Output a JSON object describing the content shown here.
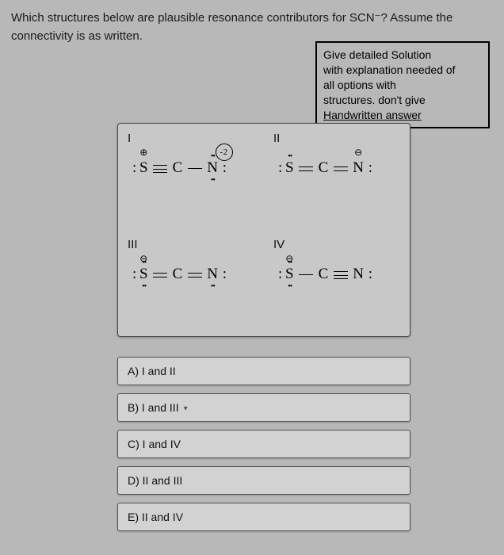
{
  "question": "Which structures below are plausible resonance contributors for SCN⁻? Assume the connectivity is as written.",
  "note": {
    "line1": "Give detailed Solution",
    "line2": "with explanation needed of",
    "line3": "all options with",
    "line4": "structures. don't give",
    "line5": "Handwritten answer"
  },
  "structures": {
    "I": {
      "roman": "I",
      "s_charge": "⊕",
      "n_charge_circle": "-2",
      "s_dots_left": ":",
      "n_dots_top": "••",
      "n_dots_bot": "••",
      "bond1": "triple",
      "bond2": "single"
    },
    "II": {
      "roman": "II",
      "n_charge": "⊖",
      "s_dots_left": ":",
      "s_dots_top": "••",
      "n_dots_top": "",
      "n_right": ":",
      "bond1": "double",
      "bond2": "double"
    },
    "III": {
      "roman": "III",
      "s_charge": "⊖",
      "s_dots_left": ":",
      "s_dots_top": "••",
      "s_dots_bot": "••",
      "n_right": ":",
      "n_dots_bot": "••",
      "bond1": "double",
      "bond2": "double"
    },
    "IV": {
      "roman": "IV",
      "s_charge": "⊖",
      "s_dots_left": ":",
      "s_dots_top": "••",
      "s_dots_bot": "••",
      "n_right": ":",
      "bond1": "single",
      "bond2": "triple"
    }
  },
  "options": {
    "A": "A) I and II",
    "B": "B) I and III",
    "C": "C) I and IV",
    "D": "D) II and III",
    "E": "E) II and IV"
  },
  "option_B_marker": "▾"
}
